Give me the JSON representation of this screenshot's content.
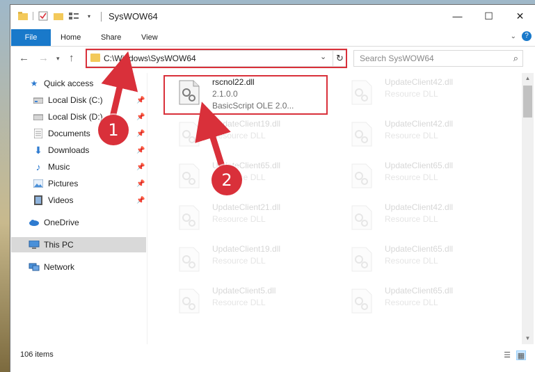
{
  "window": {
    "title": "SysWOW64",
    "controls": {
      "minimize": "—",
      "maximize": "☐",
      "close": "✕"
    }
  },
  "ribbon": {
    "tabs": [
      {
        "label": "File"
      },
      {
        "label": "Home"
      },
      {
        "label": "Share"
      },
      {
        "label": "View"
      }
    ]
  },
  "nav": {
    "address": "C:\\Windows\\SysWOW64",
    "search_placeholder": "Search SysWOW64"
  },
  "sidebar": {
    "quick_access": "Quick access",
    "items": [
      {
        "label": "Local Disk (C:)",
        "icon": "drive-icon",
        "pinned": true
      },
      {
        "label": "Local Disk (D:)",
        "icon": "drive-icon",
        "pinned": true
      },
      {
        "label": "Documents",
        "icon": "documents-icon",
        "pinned": true
      },
      {
        "label": "Downloads",
        "icon": "downloads-icon",
        "pinned": true
      },
      {
        "label": "Music",
        "icon": "music-icon",
        "pinned": true
      },
      {
        "label": "Pictures",
        "icon": "pictures-icon",
        "pinned": true
      },
      {
        "label": "Videos",
        "icon": "videos-icon",
        "pinned": true
      }
    ],
    "onedrive": "OneDrive",
    "this_pc": "This PC",
    "network": "Network"
  },
  "files": {
    "highlighted": {
      "name": "rscnol22.dll",
      "version": "2.1.0.0",
      "description": "BasicScript OLE 2.0..."
    },
    "left_column": [
      {
        "name": "UpdateClient19.dll",
        "type": "Resource DLL"
      },
      {
        "name": "UpdateClient65.dll",
        "type": "Resource DLL"
      },
      {
        "name": "UpdateClient21.dll",
        "type": "Resource DLL"
      },
      {
        "name": "UpdateClient19.dll",
        "type": "Resource DLL"
      },
      {
        "name": "UpdateClient5.dll",
        "type": "Resource DLL"
      }
    ],
    "right_column": [
      {
        "name": "UpdateClient42.dll",
        "type": "Resource DLL"
      },
      {
        "name": "UpdateClient42.dll",
        "type": "Resource DLL"
      },
      {
        "name": "UpdateClient65.dll",
        "type": "Resource DLL"
      },
      {
        "name": "UpdateClient42.dll",
        "type": "Resource DLL"
      },
      {
        "name": "UpdateClient65.dll",
        "type": "Resource DLL"
      },
      {
        "name": "UpdateClient65.dll",
        "type": "Resource DLL"
      }
    ]
  },
  "status": {
    "item_count": "106 items"
  },
  "annotations": {
    "step1": "1",
    "step2": "2",
    "highlight_color": "#d9303a"
  }
}
